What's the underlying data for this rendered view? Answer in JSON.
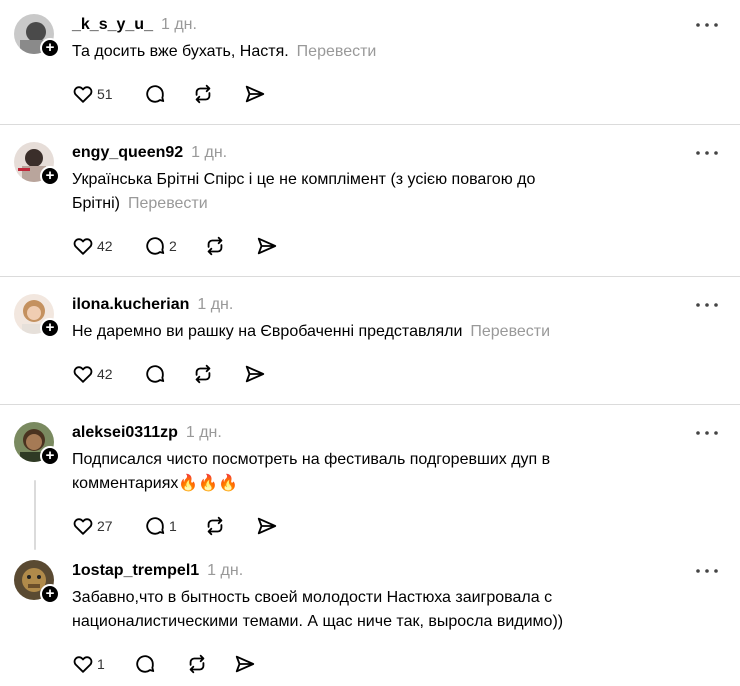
{
  "colors": {
    "text": "#000000",
    "muted": "#999999",
    "divider": "#dbdbdb"
  },
  "posts": [
    {
      "username": "_k_s_y_u_",
      "time": "1 дн.",
      "text": "Та досить вже бухать, Настя.",
      "translate": "Перевести",
      "likes": "51",
      "replies": ""
    },
    {
      "username": "engy_queen92",
      "time": "1 дн.",
      "text": "Українська Брітні Спірс і це не комплімент (з усією повагою до Брітні)",
      "translate": "Перевести",
      "likes": "42",
      "replies": "2"
    },
    {
      "username": "ilona.kucherian",
      "time": "1 дн.",
      "text": "Не даремно ви рашку на Євробаченні представляли",
      "translate": "Перевести",
      "likes": "42",
      "replies": ""
    },
    {
      "username": "aleksei0311zp",
      "time": "1 дн.",
      "text": "Подписался чисто посмотреть на фестиваль подгоревших дуп в комментариях🔥🔥🔥",
      "translate": "",
      "likes": "27",
      "replies": "1"
    },
    {
      "username": "1ostap_trempel1",
      "time": "1 дн.",
      "text": "Забавно,что в бытность своей молодости Настюха заигровала с националистическими темами. А щас ниче так, выросла видимо))",
      "translate": "",
      "likes": "1",
      "replies": ""
    }
  ],
  "icons": {
    "like": "heart-icon",
    "reply": "comment-icon",
    "repost": "repost-icon",
    "share": "send-icon",
    "more": "more-icon",
    "follow": "plus-icon"
  }
}
